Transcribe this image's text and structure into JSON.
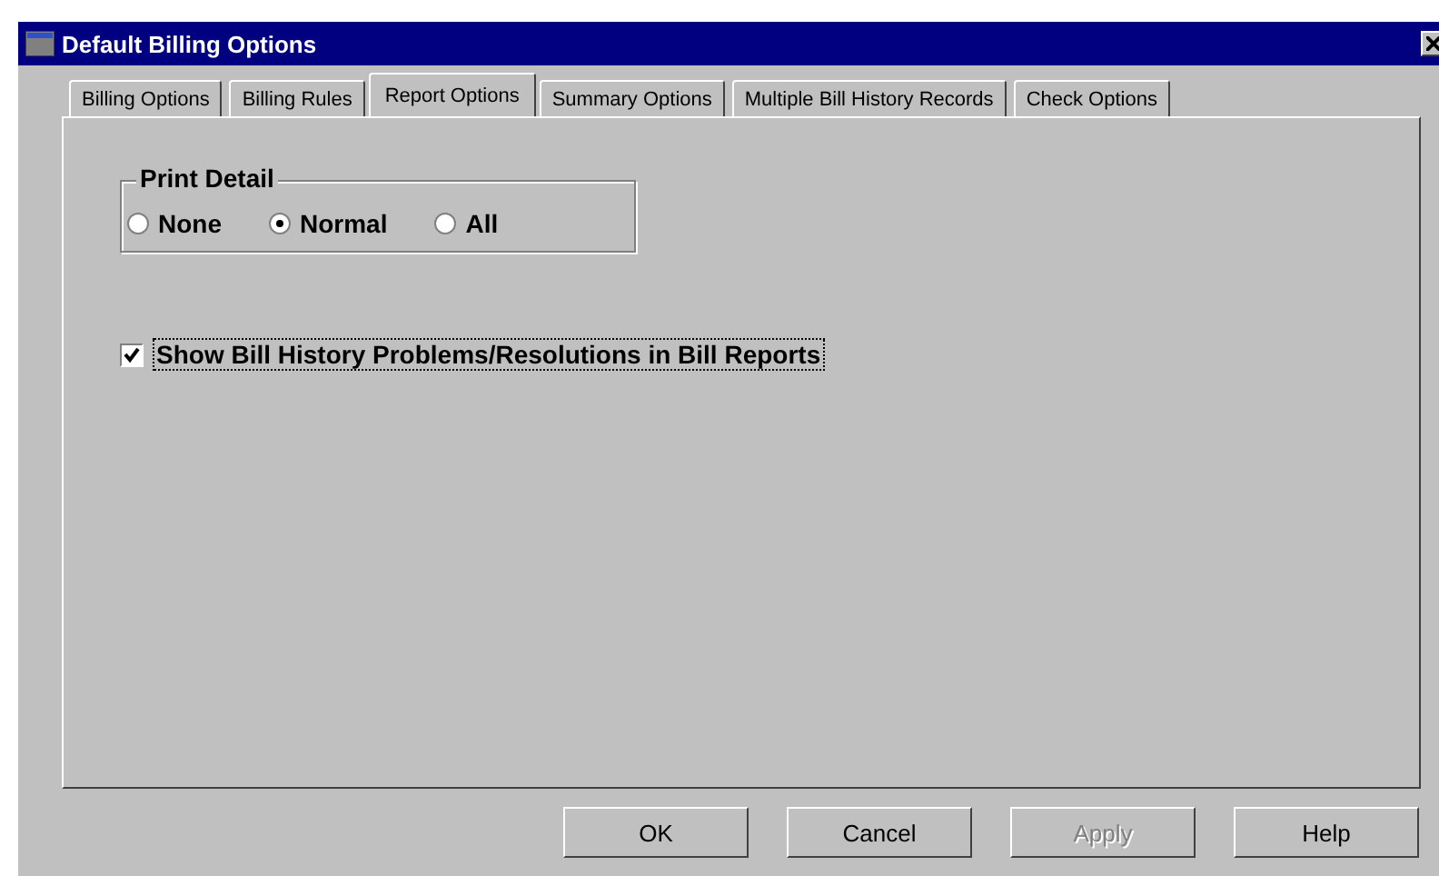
{
  "window": {
    "title": "Default Billing Options"
  },
  "tabs": [
    {
      "label": "Billing Options",
      "selected": false
    },
    {
      "label": "Billing Rules",
      "selected": false
    },
    {
      "label": "Report Options",
      "selected": true
    },
    {
      "label": "Summary Options",
      "selected": false
    },
    {
      "label": "Multiple Bill History Records",
      "selected": false
    },
    {
      "label": "Check Options",
      "selected": false
    }
  ],
  "print_detail": {
    "label": "Print Detail",
    "options": [
      {
        "label": "None",
        "selected": false
      },
      {
        "label": "Normal",
        "selected": true
      },
      {
        "label": "All",
        "selected": false
      }
    ]
  },
  "show_history": {
    "label": "Show Bill History Problems/Resolutions in Bill Reports",
    "checked": true
  },
  "buttons": [
    {
      "label": "OK",
      "disabled": false
    },
    {
      "label": "Cancel",
      "disabled": false
    },
    {
      "label": "Apply",
      "disabled": true
    },
    {
      "label": "Help",
      "disabled": false
    }
  ]
}
